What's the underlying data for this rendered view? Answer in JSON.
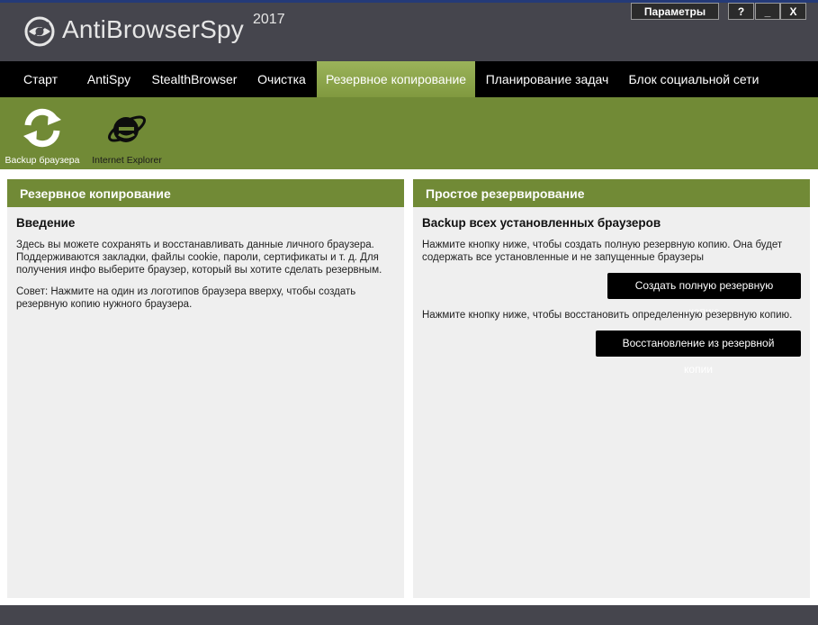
{
  "app": {
    "title": "AntiBrowserSpy",
    "year": "2017",
    "logo_icon": "eye-logo-icon"
  },
  "window_controls": {
    "params_label": "Параметры",
    "help_label": "?",
    "minimize_label": "_",
    "close_label": "X"
  },
  "nav": {
    "items": [
      {
        "label": "Старт"
      },
      {
        "label": "AntiSpy"
      },
      {
        "label": "StealthBrowser"
      },
      {
        "label": "Очистка"
      },
      {
        "label": "Резервное копирование",
        "active": true
      },
      {
        "label": "Планирование задач"
      },
      {
        "label": "Блок социальной сети"
      }
    ]
  },
  "toolbar": {
    "items": [
      {
        "label": "Backup браузера",
        "icon": "refresh-icon"
      },
      {
        "label": "Internet Explorer",
        "icon": "internet-explorer-icon"
      }
    ]
  },
  "left_panel": {
    "header": "Резервное копирование",
    "subtitle": "Введение",
    "text1": "Здесь вы можете сохранять и восстанавливать данные личного браузера. Поддерживаются закладки, файлы cookie, пароли, сертификаты и т. д. Для получения инфо выберите браузер, который вы хотите сделать резервным.",
    "text2": "Совет: Нажмите на один из логотипов браузера вверху, чтобы создать резервную копию нужного браузера."
  },
  "right_panel": {
    "header": "Простое резервирование",
    "subtitle": "Backup всех установленных браузеров",
    "text1": "Нажмите кнопку ниже, чтобы создать полную резервную копию. Она будет содержать все установленные и не запущенные браузеры",
    "full_backup_button": "Создать полную резервную копию",
    "text2": "Нажмите кнопку ниже, чтобы восстановить определенную резервную копию.",
    "restore_button": "Восстановление из резервной копии"
  },
  "colors": {
    "accent_green": "#718a36",
    "active_tab": "#8ea64e",
    "titlebar": "#45454d",
    "navbar": "#000000",
    "panel_bg": "#efefef"
  }
}
